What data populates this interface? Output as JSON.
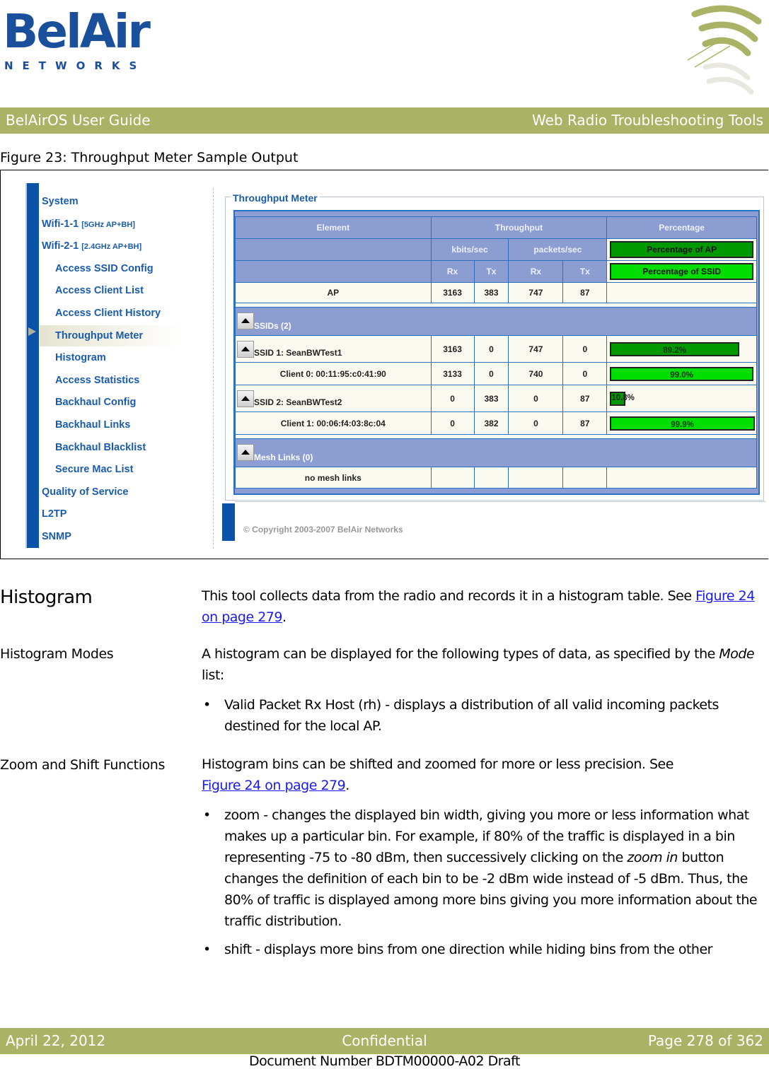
{
  "header": {
    "logo_main": "BelAir",
    "logo_sub": "NETWORKS",
    "guide_title": "BelAirOS User Guide",
    "section_title": "Web Radio Troubleshooting Tools"
  },
  "figure": {
    "caption": "Figure 23: Throughput Meter Sample Output",
    "sidebar": {
      "items": [
        {
          "label": "System",
          "sub": ""
        },
        {
          "label": "Wifi-1-1",
          "sub": "[5GHz AP+BH]"
        },
        {
          "label": "Wifi-2-1",
          "sub": "[2.4GHz AP+BH]"
        },
        {
          "label": "Access SSID Config",
          "sub": ""
        },
        {
          "label": "Access Client List",
          "sub": ""
        },
        {
          "label": "Access Client History",
          "sub": ""
        },
        {
          "label": "Throughput Meter",
          "sub": "",
          "selected": true
        },
        {
          "label": "Histogram",
          "sub": ""
        },
        {
          "label": "Access Statistics",
          "sub": ""
        },
        {
          "label": "Backhaul Config",
          "sub": ""
        },
        {
          "label": "Backhaul Links",
          "sub": ""
        },
        {
          "label": "Backhaul Blacklist",
          "sub": ""
        },
        {
          "label": "Secure Mac List",
          "sub": ""
        },
        {
          "label": "Quality of Service",
          "sub": ""
        },
        {
          "label": "L2TP",
          "sub": ""
        },
        {
          "label": "SNMP",
          "sub": ""
        }
      ]
    },
    "panel": {
      "legend": "Throughput Meter",
      "headers": {
        "element": "Element",
        "throughput": "Throughput",
        "percentage": "Percentage",
        "kbits": "kbits/sec",
        "packets": "packets/sec",
        "rx": "Rx",
        "tx": "Tx",
        "pct_ap": "Percentage of AP",
        "pct_ssid": "Percentage of SSID"
      },
      "colors": {
        "pct_ap": "#009900",
        "pct_ssid": "#00dd00"
      },
      "ap_row": {
        "name": "AP",
        "kb_rx": "3163",
        "kb_tx": "383",
        "pk_rx": "747",
        "pk_tx": "87"
      },
      "ssids_group": "SSIDs (2)",
      "rows": [
        {
          "name": "SSID 1: SeanBWTest1",
          "type": "ssid",
          "kb_rx": "3163",
          "kb_tx": "0",
          "pk_rx": "747",
          "pk_tx": "0",
          "pct_label": "89.2%",
          "pct": 89.2
        },
        {
          "name": "Client 0: 00:11:95:c0:41:90",
          "type": "client",
          "kb_rx": "3133",
          "kb_tx": "0",
          "pk_rx": "740",
          "pk_tx": "0",
          "pct_label": "99.0%",
          "pct": 99.0
        },
        {
          "name": "SSID 2: SeanBWTest2",
          "type": "ssid",
          "kb_rx": "0",
          "kb_tx": "383",
          "pk_rx": "0",
          "pk_tx": "87",
          "pct_label": "10.8%",
          "pct": 10.8
        },
        {
          "name": "Client 1: 00:06:f4:03:8c:04",
          "type": "client",
          "kb_rx": "0",
          "kb_tx": "382",
          "pk_rx": "0",
          "pk_tx": "87",
          "pct_label": "99.9%",
          "pct": 99.9
        }
      ],
      "mesh_group": "Mesh Links (0)",
      "mesh_row": "no mesh links"
    },
    "copyright": "© Copyright 2003-2007 BelAir Networks"
  },
  "content": {
    "histogram_heading": "Histogram",
    "histogram_text": "This tool collects data from the radio and records it in a histogram table. See ",
    "histogram_link": "Figure 24 on page 279",
    "modes_heading": "Histogram Modes",
    "modes_text_a": "A histogram can be displayed for the following types of data, as specified by the ",
    "modes_text_em": "Mode",
    "modes_text_b": " list:",
    "modes_bullet": "Valid Packet Rx Host (rh) - displays a distribution of all valid incoming packets destined for the local AP.",
    "zoom_heading": "Zoom and Shift Functions",
    "zoom_text": "Histogram bins can be shifted and zoomed for more or less precision. See ",
    "zoom_link": "Figure 24 on page 279",
    "zoom_bullet_a": "zoom - changes the displayed bin width, giving you more or less information what makes up a particular bin. For example, if 80% of the traffic is displayed in a bin representing -75 to -80 dBm, then successively clicking on the ",
    "zoom_bullet_em": "zoom in",
    "zoom_bullet_b": " button changes the definition of each bin to be -2 dBm wide instead of -5 dBm. Thus, the 80% of traffic is displayed among more bins giving you more information about the traffic distribution.",
    "shift_bullet": "shift - displays more bins from one direction while hiding bins from the other",
    "bullet_glyph": "•"
  },
  "footer": {
    "date": "April 22, 2012",
    "confidential": "Confidential",
    "page": "Page 278 of 362",
    "doc_number": "Document Number BDTM00000-A02 Draft"
  }
}
